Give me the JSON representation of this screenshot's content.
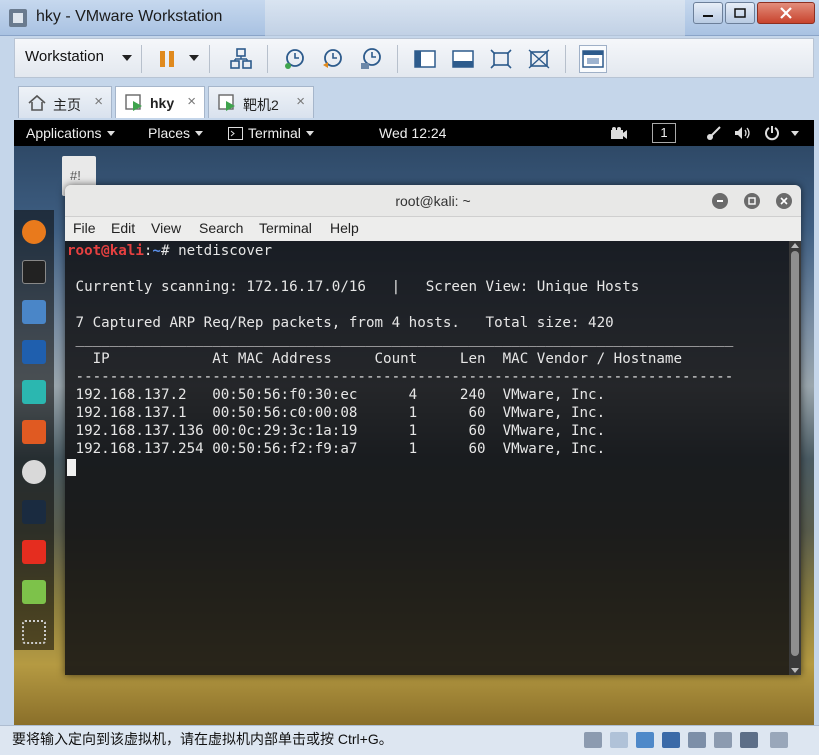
{
  "window": {
    "title": "hky - VMware Workstation"
  },
  "toolbar": {
    "workstation_label": "Workstation"
  },
  "tabs": [
    {
      "label": "主页",
      "close": "×"
    },
    {
      "label": "hky",
      "close": "×"
    },
    {
      "label": "靶机2",
      "close": "×"
    }
  ],
  "guest_bar": {
    "applications": "Applications",
    "places": "Places",
    "terminal": "Terminal",
    "clock": "Wed 12:24",
    "workspace": "1"
  },
  "desktop": {
    "file_label": "#!"
  },
  "terminal": {
    "title": "root@kali: ~",
    "menu": [
      "File",
      "Edit",
      "View",
      "Search",
      "Terminal",
      "Help"
    ],
    "prompt_user": "root@kali",
    "prompt_sep": ":",
    "prompt_path": "~",
    "prompt_symbol": "# ",
    "command": "netdiscover",
    "scanning_line": " Currently scanning: 172.16.17.0/16   |   Screen View: Unique Hosts",
    "captured_line": " 7 Captured ARP Req/Rep packets, from 4 hosts.   Total size: 420",
    "rule_top": " _____________________________________________________________________________",
    "header_line": "   IP            At MAC Address     Count     Len  MAC Vendor / Hostname",
    "rule_dash": " -----------------------------------------------------------------------------",
    "rows": [
      " 192.168.137.2   00:50:56:f0:30:ec      4     240  VMware, Inc.",
      " 192.168.137.1   00:50:56:c0:00:08      1      60  VMware, Inc.",
      " 192.168.137.136 00:0c:29:3c:1a:19      1      60  VMware, Inc.",
      " 192.168.137.254 00:50:56:f2:f9:a7      1      60  VMware, Inc."
    ]
  },
  "statusbar": {
    "message": "要将输入定向到该虚拟机，请在虚拟机内部单击或按 Ctrl+G。"
  },
  "colors": {
    "prompt_user": "#e64040",
    "prompt_path": "#5b8fe8",
    "terminal_bg": "#121214"
  }
}
